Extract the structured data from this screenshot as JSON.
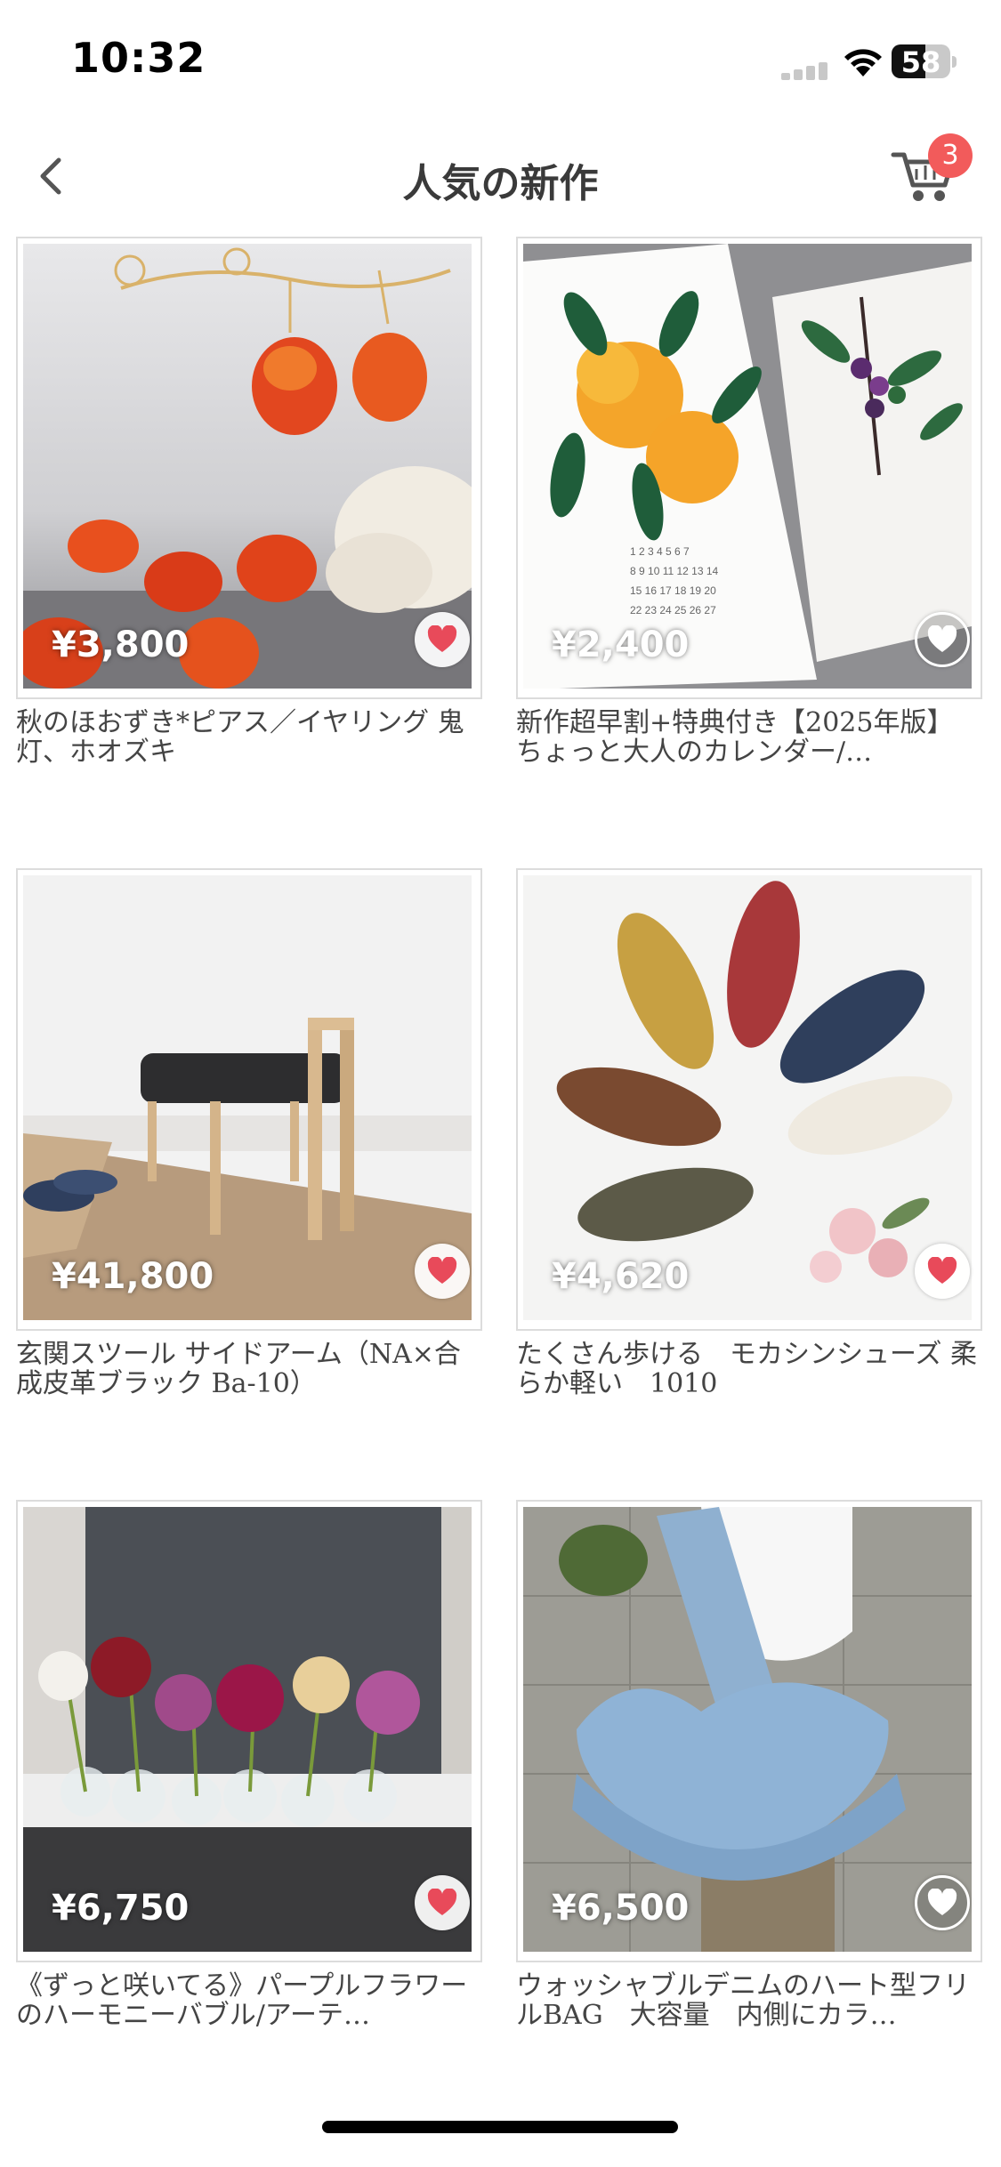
{
  "status_bar": {
    "time": "10:32",
    "battery": "58"
  },
  "nav": {
    "title": "人気の新作",
    "cart_count": "3"
  },
  "products": [
    {
      "price": "¥3,800",
      "name": "秋のほおずき*ピアス／イヤリング 鬼灯、ホオズキ",
      "favorited": true
    },
    {
      "price": "¥2,400",
      "name": "新作超早割+特典付き【2025年版】 ちょっと大人のカレンダー/…",
      "favorited": false
    },
    {
      "price": "¥41,800",
      "name": "玄関スツール サイドアーム（NA×合成皮革ブラック Ba-10）",
      "favorited": true
    },
    {
      "price": "¥4,620",
      "name": "たくさん歩ける　モカシンシューズ 柔らか軽い　1010",
      "favorited": true
    },
    {
      "price": "¥6,750",
      "name": "《ずっと咲いてる》パープルフラワーのハーモニーバブル/アーテ…",
      "favorited": true
    },
    {
      "price": "¥6,500",
      "name": "ウォッシャブルデニムのハート型フリルBAG　大容量　内側にカラ…",
      "favorited": false
    }
  ]
}
